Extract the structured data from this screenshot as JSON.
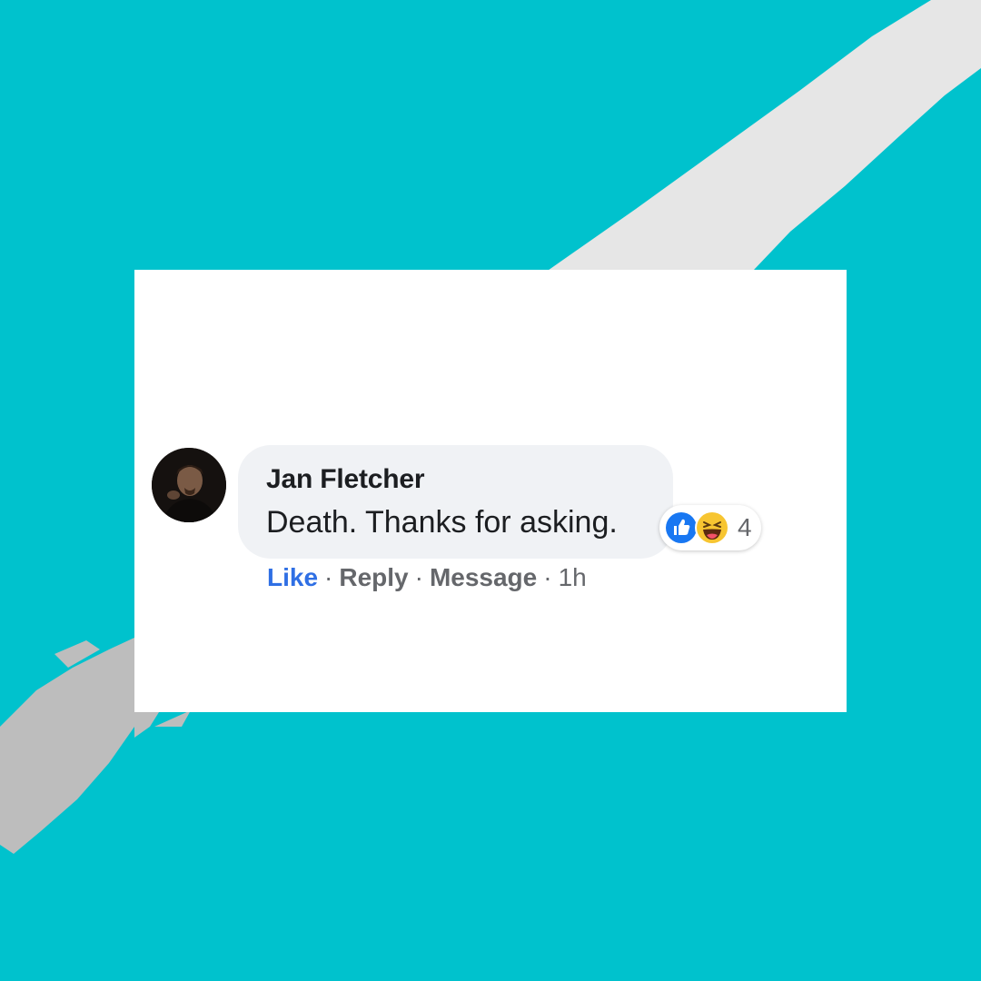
{
  "colors": {
    "background": "#00c2cd",
    "card": "#ffffff",
    "bubble": "#f0f2f5",
    "like_blue": "#2f6fe4",
    "meta_gray": "#65676b",
    "brush": "#e6e6e6"
  },
  "comment": {
    "author": "Jan Fletcher",
    "text": "Death. Thanks for asking.",
    "avatar": "avatar-photo",
    "reactions": {
      "icons": [
        "like-reaction-icon",
        "haha-reaction-icon"
      ],
      "count": "4"
    },
    "actions": {
      "like": "Like",
      "reply": "Reply",
      "message": "Message",
      "separator": "·",
      "time": "1h"
    }
  }
}
